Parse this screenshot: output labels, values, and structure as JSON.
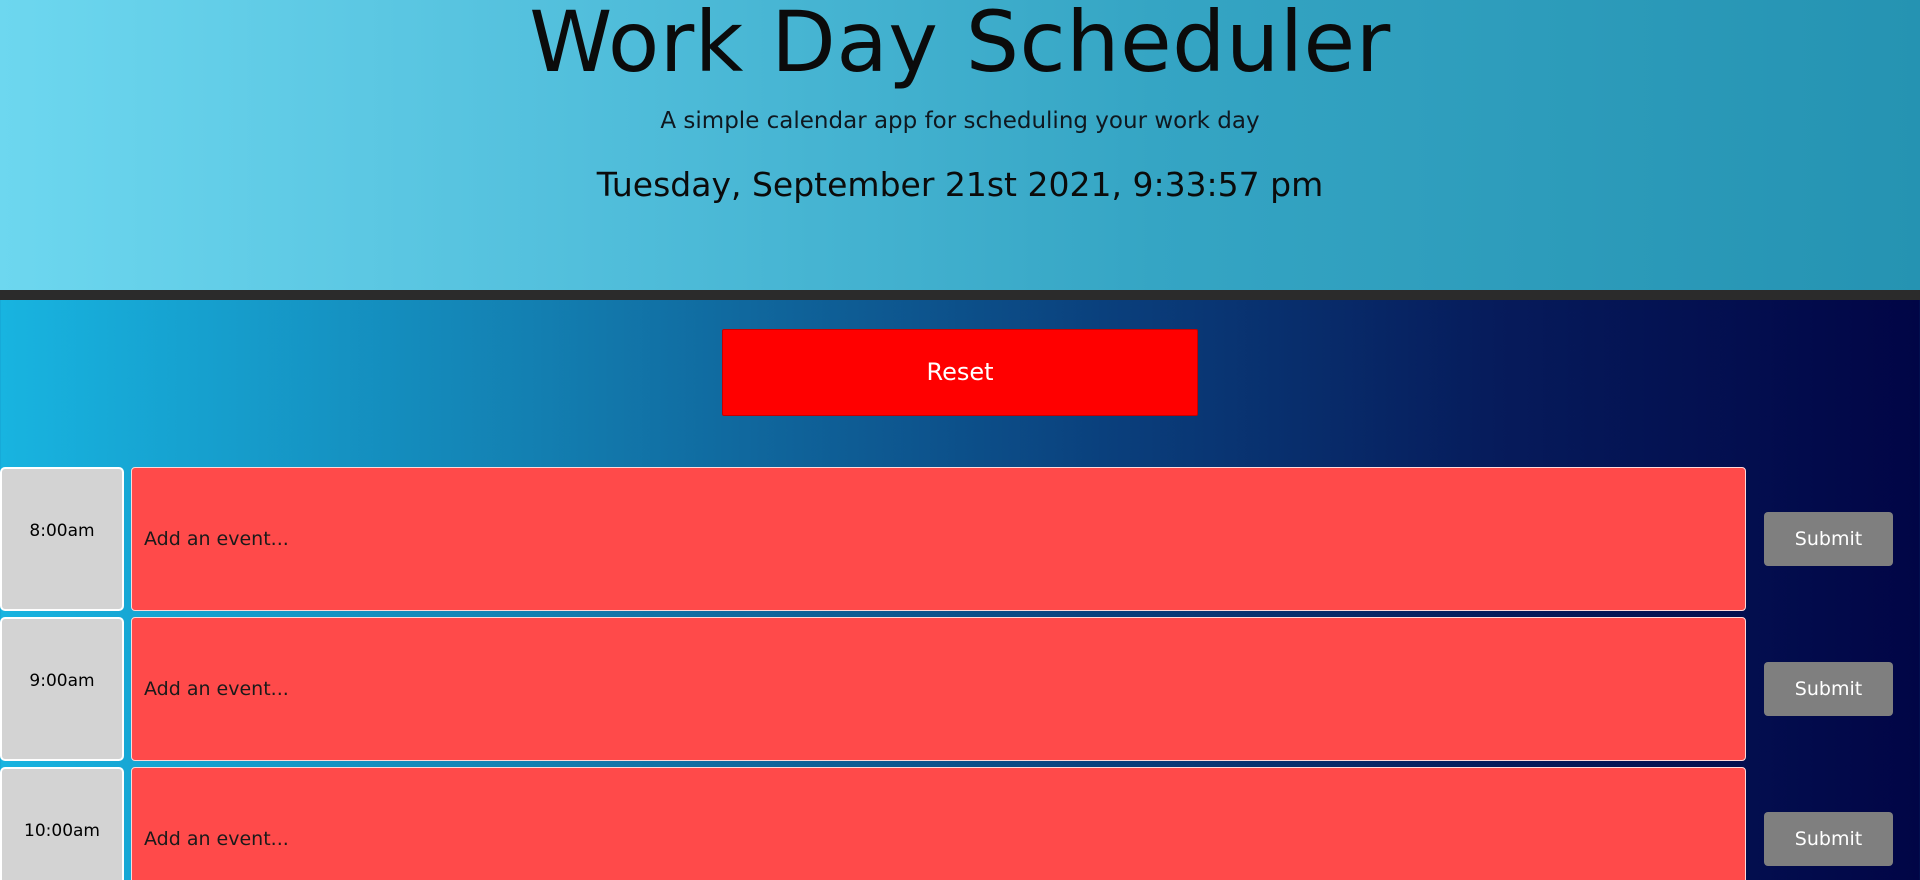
{
  "header": {
    "title": "Work Day Scheduler",
    "subtitle": "A simple calendar app for scheduling your work day",
    "current_datetime": "Tuesday, September 21st 2021, 9:33:57 pm"
  },
  "reset_button": {
    "label": "Reset",
    "color": "#ff0000"
  },
  "colors": {
    "event_background": "#ff4a4a",
    "hour_background": "#d3d3d3",
    "submit_background": "#7f7f7f",
    "divider": "#2b2b2b"
  },
  "time_blocks": [
    {
      "hour": "8:00am",
      "placeholder": "Add an event...",
      "submit_label": "Submit"
    },
    {
      "hour": "9:00am",
      "placeholder": "Add an event...",
      "submit_label": "Submit"
    },
    {
      "hour": "10:00am",
      "placeholder": "Add an event...",
      "submit_label": "Submit"
    }
  ]
}
